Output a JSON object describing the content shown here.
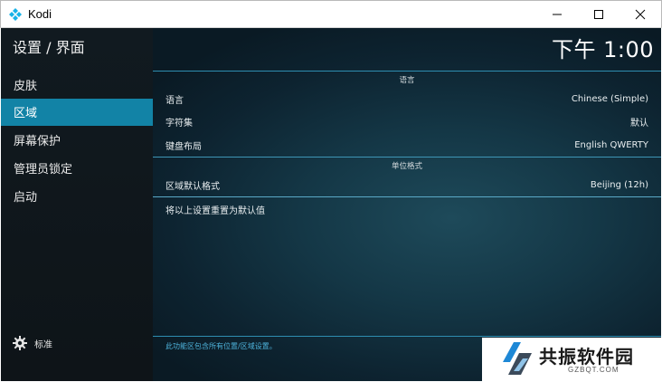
{
  "window": {
    "title": "Kodi",
    "minimize_glyph": "─",
    "maximize_glyph": "☐",
    "close_glyph": "✕"
  },
  "sidebar": {
    "title": "设置 / 界面",
    "items": [
      {
        "label": "皮肤",
        "active": false
      },
      {
        "label": "区域",
        "active": true
      },
      {
        "label": "屏幕保护",
        "active": false
      },
      {
        "label": "管理员锁定",
        "active": false
      },
      {
        "label": "启动",
        "active": false
      }
    ],
    "footer": {
      "icon": "gear-icon",
      "label": "标准"
    }
  },
  "header": {
    "clock": "下午 1:00"
  },
  "groups": {
    "language": {
      "title": "语言"
    },
    "units": {
      "title": "单位格式"
    }
  },
  "settings": {
    "language": {
      "label": "语言",
      "value": "Chinese (Simple)"
    },
    "charset": {
      "label": "字符集",
      "value": "默认"
    },
    "keyboard": {
      "label": "键盘布局",
      "value": "English QWERTY"
    },
    "region": {
      "label": "区域默认格式",
      "value": "Beijing (12h)"
    },
    "reset": {
      "label": "将以上设置重置为默认值"
    }
  },
  "footer": {
    "hint": "此功能区包含所有位置/区域设置。"
  },
  "watermark": {
    "name": "共振软件园",
    "domain": "GZBQT.COM"
  },
  "colors": {
    "accent": "#1283a6",
    "background": "#0f2230",
    "hint": "#4db1d9"
  }
}
